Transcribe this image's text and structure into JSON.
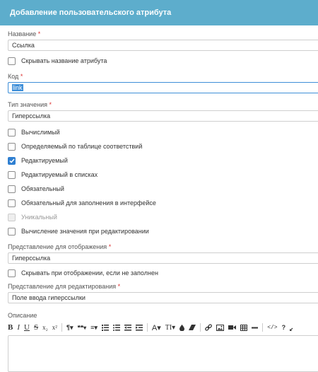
{
  "dialog": {
    "title": "Добавление пользовательского атрибута"
  },
  "fields": {
    "name_label": "Название",
    "name_value": "Ссылка",
    "hide_name": "Скрывать название атрибута",
    "code_label": "Код",
    "code_value": "link",
    "type_label": "Тип значения",
    "type_value": "Гиперссылка"
  },
  "checkboxes": [
    {
      "label": "Вычислимый",
      "checked": false,
      "disabled": false
    },
    {
      "label": "Определяемый по таблице соответствий",
      "checked": false,
      "disabled": false
    },
    {
      "label": "Редактируемый",
      "checked": true,
      "disabled": false
    },
    {
      "label": "Редактируемый в списках",
      "checked": false,
      "disabled": false
    },
    {
      "label": "Обязательный",
      "checked": false,
      "disabled": false
    },
    {
      "label": "Обязательный для заполнения в интерфейсе",
      "checked": false,
      "disabled": false
    },
    {
      "label": "Уникальный",
      "checked": false,
      "disabled": true
    },
    {
      "label": "Вычисление значения при редактировании",
      "checked": false,
      "disabled": false
    }
  ],
  "display": {
    "label": "Представление для отображения",
    "value": "Гиперссылка",
    "hide_empty": "Скрывать при отображении, если не заполнен"
  },
  "edit": {
    "label": "Представление для редактирования",
    "value": "Поле ввода гиперссылки"
  },
  "description": {
    "label": "Описание"
  },
  "required_mark": "*",
  "toolbar": {
    "bold": "B",
    "italic": "I",
    "underline": "U",
    "strike": "S",
    "subscript": "x₂",
    "superscript": "x²",
    "paragraph": "¶▾",
    "quote": "❝❝▾",
    "align": "≡▾",
    "font": "A▾",
    "text_size": "TI▾",
    "help": "?",
    "code": "</>"
  },
  "colors": {
    "header": "#5dadcc",
    "accent": "#2f7fd1",
    "required": "#d33333"
  }
}
